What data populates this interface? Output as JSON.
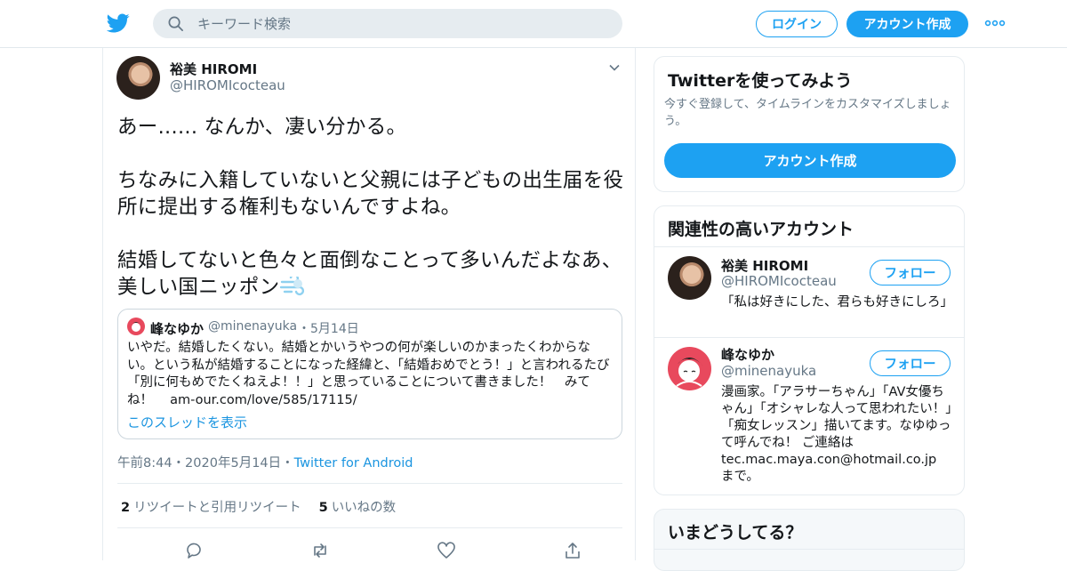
{
  "header": {
    "search_placeholder": "キーワード検索",
    "login_label": "ログイン",
    "signup_label": "アカウント作成"
  },
  "tweet": {
    "author_name": "裕美 HIROMI",
    "author_handle": "@HIROMIcocteau",
    "text_paragraphs": [
      "あー...... なんか、凄い分かる。",
      "ちなみに入籍していないと父親には子どもの出生届を役所に提出する権利もないんですよね。",
      "結婚してないと色々と面倒なことって多いんだよなあ、美しい国ニッポン"
    ],
    "emoji": "dashing-away-emoji",
    "quoted": {
      "author_name": "峰なゆか",
      "author_handle": "@minenayuka",
      "date": "・5月14日",
      "body": "いやだ。結婚したくない。結婚とかいうやつの何が楽しいのかまったくわからない。という私が結婚することになった経緯と、「結婚おめでとう！」と言われるたび「別に何もめでたくねえよ！！」と思っていることについて書きました！　みてね！　 am-our.com/love/585/17115/",
      "thread_link": "このスレッドを表示"
    },
    "time": "午前8:44",
    "date": "・2020年5月14日",
    "separator": "・",
    "source": "Twitter for Android",
    "retweet_count": "2",
    "retweet_label": "リツイートと引用リツイート",
    "like_count": "5",
    "like_label": "いいねの数"
  },
  "sidebar": {
    "signup_card": {
      "title": "Twitterを使ってみよう",
      "description": "今すぐ登録して、タイムラインをカスタマイズしましょう。",
      "button": "アカウント作成"
    },
    "related": {
      "title": "関連性の高いアカウント",
      "follow_label": "フォロー",
      "accounts": [
        {
          "name": "裕美 HIROMI",
          "handle": "@HIROMIcocteau",
          "bio": "「私は好きにした、君らも好きにしろ」"
        },
        {
          "name": "峰なゆか",
          "handle": "@minenayuka",
          "bio": "漫画家。「アラサーちゃん」「AV女優ちゃん」「オシャレな人って思われたい！」「痴女レッスン」描いてます。なゆゆって呼んでね！ ご連絡は tec.mac.maya.con@hotmail.co.jp まで。"
        }
      ]
    },
    "trends_title": "いまどうしてる？"
  },
  "colors": {
    "accent": "#1da1f2",
    "link": "#1b95e0",
    "secondary_text": "#657786",
    "border": "#e6ecf0"
  }
}
